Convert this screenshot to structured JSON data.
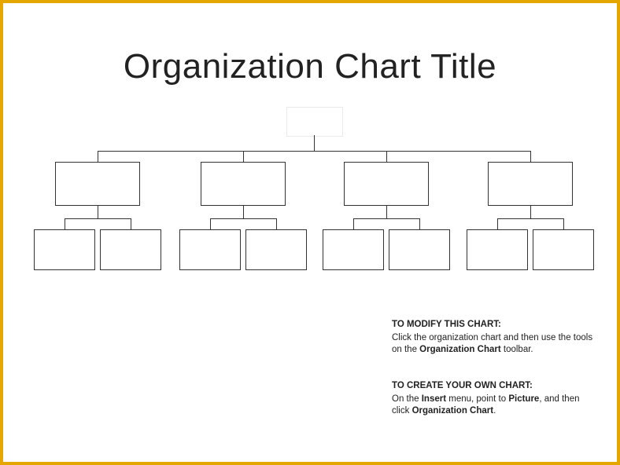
{
  "title": "Organization Chart Title",
  "chart_data": {
    "type": "org-chart",
    "title": "Organization Chart Title",
    "root": {
      "label": "",
      "children": [
        {
          "label": "",
          "children": [
            {
              "label": ""
            },
            {
              "label": ""
            }
          ]
        },
        {
          "label": "",
          "children": [
            {
              "label": ""
            },
            {
              "label": ""
            }
          ]
        },
        {
          "label": "",
          "children": [
            {
              "label": ""
            },
            {
              "label": ""
            }
          ]
        },
        {
          "label": "",
          "children": [
            {
              "label": ""
            },
            {
              "label": ""
            }
          ]
        }
      ]
    },
    "colors": {
      "mid_top": "#d9d8f2",
      "leaf_top": "#bde8ec",
      "border": "#333333",
      "frame": "#e6a600"
    }
  },
  "instructions": {
    "modify": {
      "heading": "TO MODIFY THIS CHART:",
      "body_pre": "Click the organization chart and then use the tools on the ",
      "bold1": "Organization Chart",
      "body_post": " toolbar."
    },
    "create": {
      "heading": "TO CREATE YOUR OWN CHART:",
      "body_pre": "On the ",
      "bold1": "Insert",
      "body_mid1": " menu, point to ",
      "bold2": "Picture",
      "body_mid2": ", and then click ",
      "bold3": "Organization Chart",
      "body_post": "."
    }
  }
}
